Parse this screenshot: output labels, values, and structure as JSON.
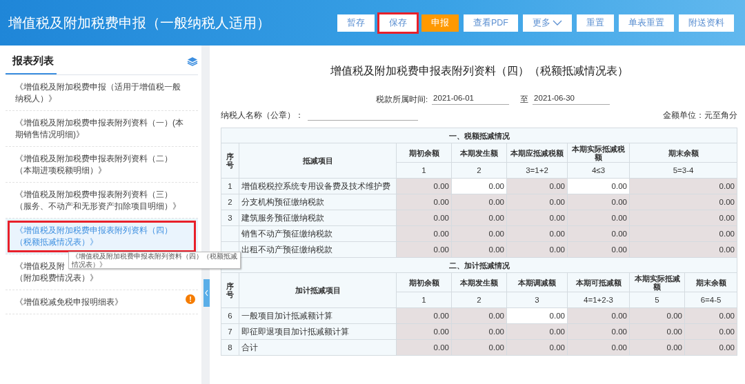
{
  "header": {
    "title": "增值税及附加税费申报（一般纳税人适用）"
  },
  "toolbar": [
    {
      "label": "暂存",
      "kind": "normal",
      "highlighted": false
    },
    {
      "label": "保存",
      "kind": "normal",
      "highlighted": true
    },
    {
      "label": "申报",
      "kind": "primary",
      "highlighted": false
    },
    {
      "label": "查看PDF",
      "kind": "normal",
      "highlighted": false
    },
    {
      "label": "更多",
      "kind": "dropdown",
      "highlighted": false
    },
    {
      "label": "重置",
      "kind": "normal",
      "highlighted": false
    },
    {
      "label": "单表重置",
      "kind": "normal",
      "highlighted": false
    },
    {
      "label": "附送资料",
      "kind": "normal",
      "highlighted": false
    }
  ],
  "sidebar": {
    "title": "报表列表",
    "items": [
      {
        "lines": [
          "《增值税及附加税费申报（适用于增值税一般",
          "纳税人）》"
        ],
        "selected": false,
        "highlighted": false
      },
      {
        "lines": [
          "《增值税及附加税费申报表附列资料（一）(本",
          "期销售情况明细)》"
        ],
        "selected": false,
        "highlighted": false
      },
      {
        "lines": [
          "《增值税及附加税费申报表附列资料（二）",
          "（本期进项税额明细）》"
        ],
        "selected": false,
        "highlighted": false
      },
      {
        "lines": [
          "《增值税及附加税费申报表附列资料（三）",
          "（服务、不动产和无形资产扣除项目明细）》"
        ],
        "selected": false,
        "highlighted": false
      },
      {
        "lines": [
          "《增值税及附加税费申报表附列资料（四）",
          "（税额抵减情况表）》"
        ],
        "selected": true,
        "highlighted": true
      },
      {
        "lines": [
          "《增值税及附",
          "（附加税费情况表）》"
        ],
        "selected": false,
        "highlighted": false
      },
      {
        "lines": [
          "《增值税减免税申报明细表》"
        ],
        "selected": false,
        "highlighted": false,
        "badge": "!"
      }
    ]
  },
  "tooltip": {
    "lines": [
      "《增值税及附加税费申报表附列资料（四）（税额抵减",
      "情况表）》"
    ]
  },
  "sheet": {
    "title": "增值税及附加税费申报表附列资料（四）（税额抵减情况表）",
    "period_label": "税款所属时间:",
    "period_from": "2021-06-01",
    "period_sep": "至",
    "period_to": "2021-06-30",
    "taxpayer_label": "纳税人名称（公章）：",
    "unit": "金额单位：元至角分",
    "sections": [
      {
        "title": "一、税额抵减情况",
        "seq_header": "序号",
        "item_header": "抵减项目",
        "columns": [
          {
            "label": "期初余额",
            "formula": "1"
          },
          {
            "label": "本期发生额",
            "formula": "2"
          },
          {
            "label": "本期应抵减税额",
            "formula": "3=1+2"
          },
          {
            "label": "本期实际抵减税额",
            "formula": "4≤3"
          },
          {
            "label": "期末余额",
            "formula": "5=3-4"
          }
        ],
        "rows": [
          {
            "seq": "1",
            "item": "增值税税控系统专用设备费及技术维护费",
            "cells": [
              {
                "value": "0.00",
                "editable": false
              },
              {
                "value": "0.00",
                "editable": true
              },
              {
                "value": "0.00",
                "editable": false
              },
              {
                "value": "0.00",
                "editable": true
              },
              {
                "value": "0.00",
                "editable": false
              }
            ]
          },
          {
            "seq": "2",
            "item": "分支机构预征缴纳税款",
            "cells": [
              {
                "value": "0.00",
                "editable": false
              },
              {
                "value": "0.00",
                "editable": false
              },
              {
                "value": "0.00",
                "editable": false
              },
              {
                "value": "0.00",
                "editable": false
              },
              {
                "value": "0.00",
                "editable": false
              }
            ]
          },
          {
            "seq": "3",
            "item": "建筑服务预征缴纳税款",
            "cells": [
              {
                "value": "0.00",
                "editable": false
              },
              {
                "value": "0.00",
                "editable": false
              },
              {
                "value": "0.00",
                "editable": false
              },
              {
                "value": "0.00",
                "editable": false
              },
              {
                "value": "0.00",
                "editable": false
              }
            ]
          },
          {
            "item": "销售不动产预征缴纳税款",
            "cells": [
              {
                "value": "0.00",
                "editable": false
              },
              {
                "value": "0.00",
                "editable": false
              },
              {
                "value": "0.00",
                "editable": false
              },
              {
                "value": "0.00",
                "editable": false
              },
              {
                "value": "0.00",
                "editable": false
              }
            ]
          },
          {
            "item": "出租不动产预征缴纳税款",
            "cells": [
              {
                "value": "0.00",
                "editable": false
              },
              {
                "value": "0.00",
                "editable": false
              },
              {
                "value": "0.00",
                "editable": false
              },
              {
                "value": "0.00",
                "editable": false
              },
              {
                "value": "0.00",
                "editable": false
              }
            ]
          }
        ]
      },
      {
        "title": "二、加计抵减情况",
        "seq_header": "序号",
        "item_header": "加计抵减项目",
        "columns": [
          {
            "label": "期初余额",
            "formula": "1"
          },
          {
            "label": "本期发生额",
            "formula": "2"
          },
          {
            "label": "本期调减额",
            "formula": "3"
          },
          {
            "label": "本期可抵减额",
            "formula": "4=1+2-3"
          },
          {
            "label": "本期实际抵减额",
            "formula": "5"
          },
          {
            "label": "期末余额",
            "formula": "6=4-5"
          }
        ],
        "rows": [
          {
            "seq": "6",
            "item": "一般项目加计抵减额计算",
            "cells": [
              {
                "value": "0.00",
                "editable": false
              },
              {
                "value": "0.00",
                "editable": false
              },
              {
                "value": "0.00",
                "editable": true
              },
              {
                "value": "0.00",
                "editable": false
              },
              {
                "value": "0.00",
                "editable": false
              },
              {
                "value": "0.00",
                "editable": false
              }
            ]
          },
          {
            "seq": "7",
            "item": "即征即退项目加计抵减额计算",
            "cells": [
              {
                "value": "0.00",
                "editable": false
              },
              {
                "value": "0.00",
                "editable": false
              },
              {
                "value": "0.00",
                "editable": false
              },
              {
                "value": "0.00",
                "editable": false
              },
              {
                "value": "0.00",
                "editable": false
              },
              {
                "value": "0.00",
                "editable": false
              }
            ]
          },
          {
            "seq": "8",
            "item": "合计",
            "cells": [
              {
                "value": "0.00",
                "editable": false
              },
              {
                "value": "0.00",
                "editable": false
              },
              {
                "value": "0.00",
                "editable": false
              },
              {
                "value": "0.00",
                "editable": false
              },
              {
                "value": "0.00",
                "editable": false
              },
              {
                "value": "0.00",
                "editable": false
              }
            ]
          }
        ]
      }
    ]
  }
}
